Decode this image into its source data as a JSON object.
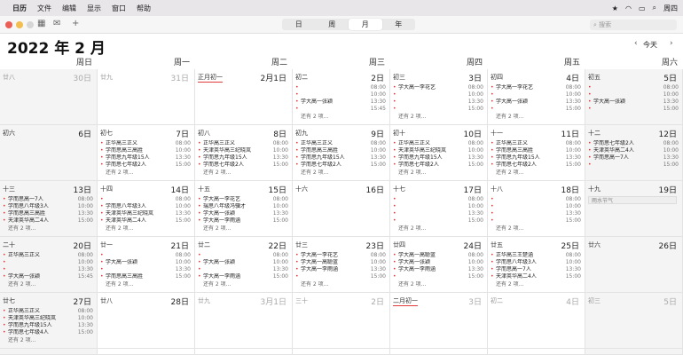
{
  "menubar": {
    "app": "日历",
    "menus": [
      "文件",
      "编辑",
      "显示",
      "窗口",
      "帮助"
    ],
    "clock": "周四"
  },
  "toolbar": {
    "views": [
      "日",
      "周",
      "月",
      "年"
    ],
    "active_view": 2,
    "search_placeholder": "搜索",
    "today_label": "今天"
  },
  "title": "2022 年 2 月",
  "weekdays": [
    "周日",
    "周一",
    "周二",
    "周三",
    "周四",
    "周五",
    "周六"
  ],
  "colors": {
    "event_dot": "#e23b3b",
    "today_underline": "#e23b3b"
  },
  "days": [
    {
      "lunar": "廿八",
      "date": "30日",
      "dim": true,
      "gray": true,
      "events": []
    },
    {
      "lunar": "廿九",
      "date": "31日",
      "dim": true,
      "gray": false,
      "events": []
    },
    {
      "lunar": "正月初一",
      "date": "2月1日",
      "red": true,
      "events": []
    },
    {
      "lunar": "初二",
      "date": "2日",
      "events": [
        {
          "t": "",
          "tm": "08:00"
        },
        {
          "t": "",
          "tm": "10:00"
        },
        {
          "t": "学大高一张颖",
          "tm": "13:30"
        },
        {
          "t": "",
          "tm": "15:45"
        }
      ],
      "more": "还有 2 项..."
    },
    {
      "lunar": "初三",
      "date": "3日",
      "events": [
        {
          "t": "学大高一李花艺",
          "tm": "08:00"
        },
        {
          "t": "",
          "tm": "10:00"
        },
        {
          "t": "",
          "tm": "13:30"
        },
        {
          "t": "",
          "tm": "15:00"
        }
      ],
      "more": "还有 2 项..."
    },
    {
      "lunar": "初四",
      "date": "4日",
      "events": [
        {
          "t": "学大高一李花艺",
          "tm": "08:00"
        },
        {
          "t": "",
          "tm": "10:00"
        },
        {
          "t": "学大高一张颖",
          "tm": "13:30"
        },
        {
          "t": "",
          "tm": "15:00"
        }
      ],
      "more": "还有 2 项..."
    },
    {
      "lunar": "初五",
      "date": "5日",
      "gray": true,
      "events": [
        {
          "t": "",
          "tm": "08:00"
        },
        {
          "t": "",
          "tm": "10:00"
        },
        {
          "t": "学大高一张颖",
          "tm": "13:30"
        },
        {
          "t": "",
          "tm": "15:00"
        }
      ]
    },
    {
      "lunar": "初六",
      "date": "6日",
      "gray": true,
      "events": []
    },
    {
      "lunar": "初七",
      "date": "7日",
      "events": [
        {
          "t": "正华高三正义",
          "tm": "08:00"
        },
        {
          "t": "学而思高三高胜",
          "tm": "10:00"
        },
        {
          "t": "学而思九年级15人",
          "tm": "13:30"
        },
        {
          "t": "学而思七年级2人",
          "tm": "15:00"
        }
      ],
      "more": "还有 2 项..."
    },
    {
      "lunar": "初八",
      "date": "8日",
      "events": [
        {
          "t": "正华高三正义",
          "tm": "08:00"
        },
        {
          "t": "天津英华高三纪晓岚",
          "tm": "10:00"
        },
        {
          "t": "学而思九年级15人",
          "tm": "13:30"
        },
        {
          "t": "学而思七年级2人",
          "tm": "15:00"
        }
      ],
      "more": "还有 2 项..."
    },
    {
      "lunar": "初九",
      "date": "9日",
      "events": [
        {
          "t": "正华高三正义",
          "tm": "08:00"
        },
        {
          "t": "学而思高三高胜",
          "tm": "10:00"
        },
        {
          "t": "学而思九年级15人",
          "tm": "13:30"
        },
        {
          "t": "学而思七年级2人",
          "tm": "15:00"
        }
      ],
      "more": "还有 2 项..."
    },
    {
      "lunar": "初十",
      "date": "10日",
      "events": [
        {
          "t": "正华高三正义",
          "tm": "08:00"
        },
        {
          "t": "天津英华高三纪晓岚",
          "tm": "10:00"
        },
        {
          "t": "学而思九年级15人",
          "tm": "13:30"
        },
        {
          "t": "学而思七年级2人",
          "tm": "15:00"
        }
      ],
      "more": "还有 2 项..."
    },
    {
      "lunar": "十一",
      "date": "11日",
      "events": [
        {
          "t": "正华高三正义",
          "tm": "08:00"
        },
        {
          "t": "学而思高三高胜",
          "tm": "10:00"
        },
        {
          "t": "学而思九年级15人",
          "tm": "13:30"
        },
        {
          "t": "学而思七年级2人",
          "tm": "15:00"
        }
      ],
      "more": "还有 2 项..."
    },
    {
      "lunar": "十二",
      "date": "12日",
      "gray": true,
      "events": [
        {
          "t": "学而思七年级2人",
          "tm": "08:00"
        },
        {
          "t": "天津英华高二4人",
          "tm": "10:00"
        },
        {
          "t": "学而思高一7人",
          "tm": "13:30"
        },
        {
          "t": "",
          "tm": "15:00"
        }
      ]
    },
    {
      "lunar": "十三",
      "date": "13日",
      "gray": true,
      "events": [
        {
          "t": "学而思高一7人",
          "tm": "08:00"
        },
        {
          "t": "学而思八年级3人",
          "tm": "10:00"
        },
        {
          "t": "学而思高三高胜",
          "tm": "13:30"
        },
        {
          "t": "天津英华高二4人",
          "tm": "15:00"
        }
      ],
      "more": "还有 2 项..."
    },
    {
      "lunar": "十四",
      "date": "14日",
      "events": [
        {
          "t": "",
          "tm": "08:00"
        },
        {
          "t": "学而思八年级3人",
          "tm": "10:00"
        },
        {
          "t": "天津英华高三纪晓岚",
          "tm": "13:30"
        },
        {
          "t": "天津英华高二4人",
          "tm": "15:00"
        }
      ],
      "more": "还有 2 项..."
    },
    {
      "lunar": "十五",
      "date": "15日",
      "events": [
        {
          "t": "学大高一李花艺",
          "tm": "08:00"
        },
        {
          "t": "瑞思八年级冯骥才",
          "tm": "10:00"
        },
        {
          "t": "学大高一张颖",
          "tm": "13:30"
        },
        {
          "t": "学大高一李雨涵",
          "tm": "15:00"
        }
      ],
      "more": "还有 2 项..."
    },
    {
      "lunar": "十六",
      "date": "16日",
      "events": []
    },
    {
      "lunar": "十七",
      "date": "17日",
      "events": [
        {
          "t": "",
          "tm": "08:00"
        },
        {
          "t": "",
          "tm": "10:00"
        },
        {
          "t": "",
          "tm": "13:30"
        },
        {
          "t": "",
          "tm": "15:00"
        }
      ],
      "more": "还有 2 项..."
    },
    {
      "lunar": "十八",
      "date": "18日",
      "events": [
        {
          "t": "",
          "tm": "08:00"
        },
        {
          "t": "",
          "tm": "10:00"
        },
        {
          "t": "",
          "tm": "13:30"
        },
        {
          "t": "",
          "tm": "15:00"
        }
      ],
      "more": "还有 2 项..."
    },
    {
      "lunar": "十九",
      "date": "19日",
      "gray": true,
      "holiday": "雨水节气",
      "events": []
    },
    {
      "lunar": "二十",
      "date": "20日",
      "gray": true,
      "events": [
        {
          "t": "正华高三正义",
          "tm": "08:00"
        },
        {
          "t": "",
          "tm": "10:00"
        },
        {
          "t": "",
          "tm": "13:30"
        },
        {
          "t": "学大高一张颖",
          "tm": "15:45"
        }
      ],
      "more": "还有 2 项..."
    },
    {
      "lunar": "廿一",
      "date": "21日",
      "events": [
        {
          "t": "",
          "tm": "08:00"
        },
        {
          "t": "学大高一张颖",
          "tm": "10:00"
        },
        {
          "t": "",
          "tm": "13:30"
        },
        {
          "t": "学而思高三高胜",
          "tm": "15:00"
        }
      ],
      "more": "还有 2 项..."
    },
    {
      "lunar": "廿二",
      "date": "22日",
      "events": [
        {
          "t": "",
          "tm": "08:00"
        },
        {
          "t": "学大高一张颖",
          "tm": "10:00"
        },
        {
          "t": "",
          "tm": "13:30"
        },
        {
          "t": "学大高一李雨涵",
          "tm": "15:00"
        }
      ],
      "more": "还有 2 项..."
    },
    {
      "lunar": "廿三",
      "date": "23日",
      "events": [
        {
          "t": "学大高一李花艺",
          "tm": "08:00"
        },
        {
          "t": "学大高一高聪蓝",
          "tm": "10:00"
        },
        {
          "t": "学大高一李雨涵",
          "tm": "13:30"
        },
        {
          "t": "",
          "tm": "15:00"
        }
      ],
      "more": "还有 2 项..."
    },
    {
      "lunar": "廿四",
      "date": "24日",
      "events": [
        {
          "t": "学大高一高聪蓝",
          "tm": "08:00"
        },
        {
          "t": "学大高一张颖",
          "tm": "10:00"
        },
        {
          "t": "学大高一李雨涵",
          "tm": "13:30"
        },
        {
          "t": "",
          "tm": "15:00"
        }
      ],
      "more": "还有 2 项..."
    },
    {
      "lunar": "廿五",
      "date": "25日",
      "events": [
        {
          "t": "正华高三王楚涵",
          "tm": "08:00"
        },
        {
          "t": "学而思八年级3人",
          "tm": "10:00"
        },
        {
          "t": "学而思高一7人",
          "tm": "13:30"
        },
        {
          "t": "天津英华高二4人",
          "tm": "15:00"
        }
      ],
      "more": "还有 2 项..."
    },
    {
      "lunar": "廿六",
      "date": "26日",
      "gray": true,
      "events": []
    },
    {
      "lunar": "廿七",
      "date": "27日",
      "gray": true,
      "events": [
        {
          "t": "正华高三正义",
          "tm": "08:00"
        },
        {
          "t": "天津英华高三纪晓岚",
          "tm": "10:00"
        },
        {
          "t": "学而思九年级15人",
          "tm": "13:30"
        },
        {
          "t": "学而思七年级4人",
          "tm": "15:00"
        }
      ],
      "more": "还有 2 项..."
    },
    {
      "lunar": "廿八",
      "date": "28日",
      "events": []
    },
    {
      "lunar": "廿九",
      "date": "3月1日",
      "dim": true,
      "events": []
    },
    {
      "lunar": "三十",
      "date": "2日",
      "dim": true,
      "events": []
    },
    {
      "lunar": "二月初一",
      "date": "3日",
      "dim": true,
      "red": true,
      "events": []
    },
    {
      "lunar": "初二",
      "date": "4日",
      "dim": true,
      "events": []
    },
    {
      "lunar": "初三",
      "date": "5日",
      "dim": true,
      "gray": true,
      "events": []
    }
  ]
}
